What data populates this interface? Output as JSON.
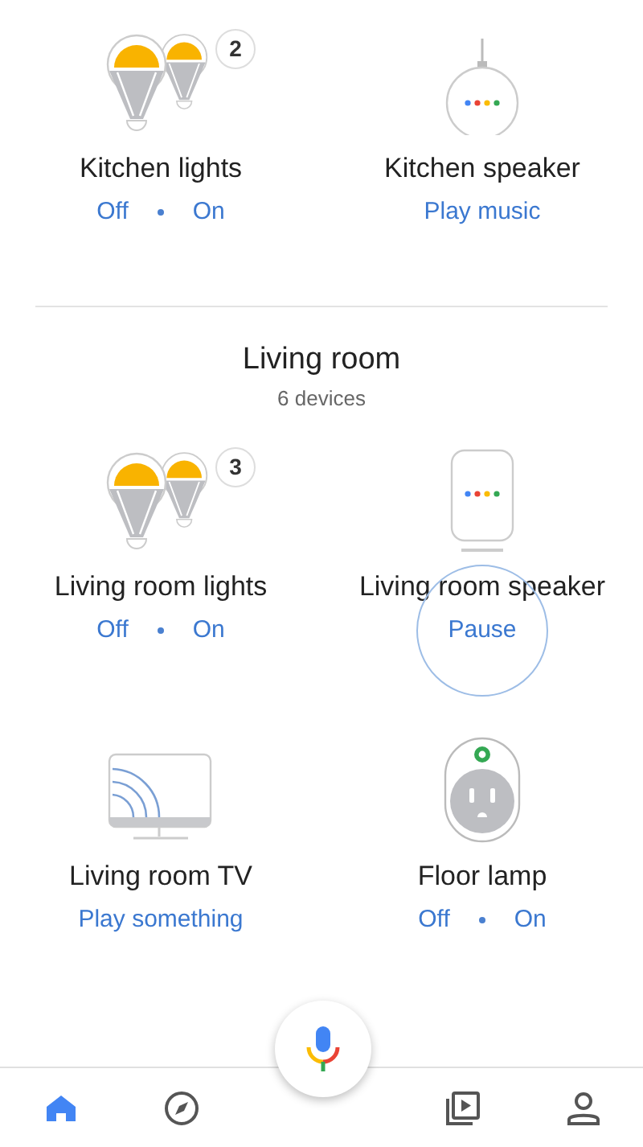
{
  "top_devices": [
    {
      "kind": "lights",
      "name": "Kitchen lights",
      "count": "2",
      "actions": [
        {
          "label": "Off",
          "pressed": false
        },
        {
          "label": "On",
          "pressed": false
        }
      ]
    },
    {
      "kind": "mini_speaker",
      "name": "Kitchen speaker",
      "actions": [
        {
          "label": "Play music",
          "pressed": false
        }
      ]
    }
  ],
  "room": {
    "title": "Living room",
    "subtitle": "6 devices",
    "devices": [
      {
        "kind": "lights",
        "name": "Living room lights",
        "count": "3",
        "actions": [
          {
            "label": "Off",
            "pressed": false
          },
          {
            "label": "On",
            "pressed": false
          }
        ]
      },
      {
        "kind": "speaker",
        "name": "Living room speaker",
        "actions": [
          {
            "label": "Pause",
            "pressed": true
          }
        ]
      },
      {
        "kind": "tv",
        "name": "Living room TV",
        "actions": [
          {
            "label": "Play something",
            "pressed": false
          }
        ]
      },
      {
        "kind": "plug",
        "name": "Floor lamp",
        "actions": [
          {
            "label": "Off",
            "pressed": false
          },
          {
            "label": "On",
            "pressed": false
          }
        ]
      }
    ]
  },
  "bottom_nav": [
    {
      "kind": "home",
      "selected": true
    },
    {
      "kind": "explore",
      "selected": false
    },
    {
      "kind": "media",
      "selected": false
    },
    {
      "kind": "account",
      "selected": false
    }
  ]
}
